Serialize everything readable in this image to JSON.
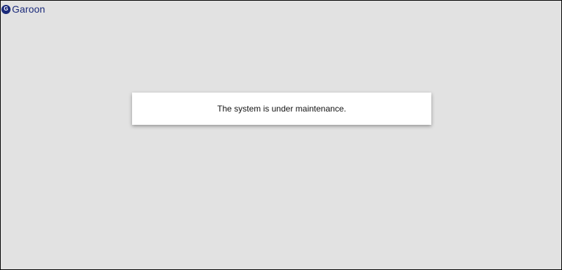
{
  "app": {
    "logo_letter": "G",
    "logo_text": "Garoon"
  },
  "colors": {
    "background": "#e2e2e2",
    "brand": "#1a2a7a",
    "panel": "#ffffff"
  },
  "maintenance": {
    "message": "The system is under maintenance."
  },
  "icons": {
    "logo": "garoon-logo-icon"
  }
}
